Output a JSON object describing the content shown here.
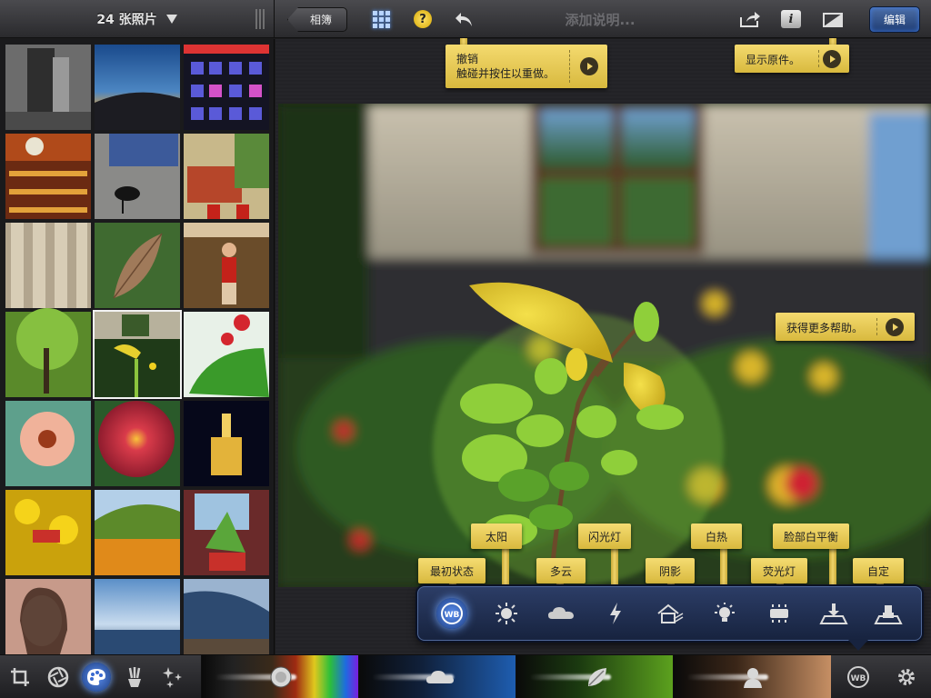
{
  "header": {
    "photo_count": "24 张照片",
    "album_button": "相簿",
    "caption_placeholder": "添加说明...",
    "edit_button": "编辑"
  },
  "tooltips": {
    "undo_title": "撤销",
    "undo_detail": "触碰并按住以重做。",
    "show_original": "显示原件。",
    "more_help": "获得更多帮助。"
  },
  "white_balance": {
    "options": [
      {
        "label": "最初状态",
        "icon": "wb-original-icon"
      },
      {
        "label": "太阳",
        "icon": "sun-icon"
      },
      {
        "label": "多云",
        "icon": "cloud-icon"
      },
      {
        "label": "闪光灯",
        "icon": "flash-icon"
      },
      {
        "label": "阴影",
        "icon": "shade-house-icon"
      },
      {
        "label": "白热",
        "icon": "incandescent-bulb-icon"
      },
      {
        "label": "荧光灯",
        "icon": "fluorescent-tube-icon"
      },
      {
        "label": "脸部白平衡",
        "icon": "face-wb-icon"
      },
      {
        "label": "自定",
        "icon": "custom-eyedropper-icon"
      }
    ],
    "selected_index": 0
  },
  "bottom_tools": [
    "crop-icon",
    "exposure-aperture-icon",
    "color-palette-icon",
    "brushes-icon",
    "effects-sparkle-icon"
  ],
  "color_sliders": [
    "saturation-rainbow-slider",
    "sky-cloud-slider",
    "foliage-leaf-slider",
    "skin-tone-slider"
  ],
  "colors": {
    "tooltip_yellow": "#e8cb55",
    "accent_blue": "#4d7fe0",
    "panel_navy": "#1f2f55"
  }
}
